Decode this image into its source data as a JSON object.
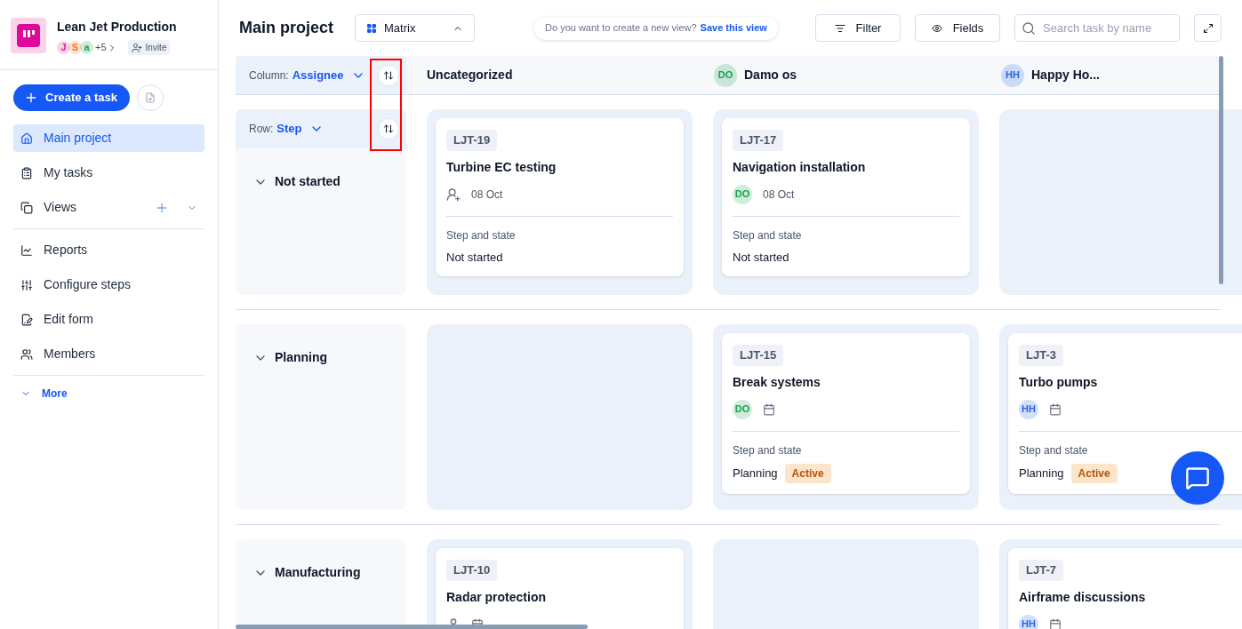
{
  "workspace": {
    "name": "Lean Jet Production",
    "members": [
      {
        "initial": "J",
        "color": "#e11d8f"
      },
      {
        "initial": "S",
        "color": "#f97316"
      },
      {
        "initial": "a",
        "color": "#16a34a"
      }
    ],
    "more_count": "+5",
    "invite": "Invite"
  },
  "create_button": "Create a task",
  "nav": [
    {
      "label": "Main project",
      "selected": true
    },
    {
      "label": "My tasks",
      "selected": false
    },
    {
      "label": "Views",
      "selected": false,
      "kind": "expandable"
    },
    {
      "label": "Reports",
      "selected": false
    },
    {
      "label": "Configure steps",
      "selected": false
    },
    {
      "label": "Edit form",
      "selected": false
    },
    {
      "label": "Members",
      "selected": false
    }
  ],
  "more": "More",
  "header": {
    "title": "Main project",
    "view": "Matrix",
    "prompt": "Do you want to create a new view?",
    "save_link": "Save this view",
    "filter": "Filter",
    "fields": "Fields",
    "search_placeholder": "Search task by name"
  },
  "column_control": {
    "label": "Column:",
    "value": "Assignee"
  },
  "row_control": {
    "label": "Row:",
    "value": "Step"
  },
  "columns": [
    {
      "label": "Uncategorized"
    },
    {
      "label": "Damo os",
      "avatar": {
        "initials": "DO",
        "color": "#16a34a"
      }
    },
    {
      "label": "Happy Ho...",
      "avatar": {
        "initials": "HH",
        "color": "#2563eb"
      }
    }
  ],
  "rows": [
    {
      "label": "Not started",
      "expanded": true,
      "cells": [
        {
          "id": "LJT-19",
          "title": "Turbine EC testing",
          "assignee": {
            "kind": "add"
          },
          "date": "08 Oct",
          "step_label": "Step and state",
          "step": "Not started"
        },
        {
          "id": "LJT-17",
          "title": "Navigation installation",
          "assignee": {
            "kind": "avatar",
            "initials": "DO",
            "color": "#16a34a"
          },
          "date": "08 Oct",
          "step_label": "Step and state",
          "step": "Not started"
        },
        null
      ]
    },
    {
      "label": "Planning",
      "expanded": true,
      "cells": [
        null,
        {
          "id": "LJT-15",
          "title": "Break systems",
          "assignee": {
            "kind": "avatar",
            "initials": "DO",
            "color": "#16a34a"
          },
          "step_label": "Step and state",
          "step": "Planning",
          "badge": "Active"
        },
        {
          "id": "LJT-3",
          "title": "Turbo pumps",
          "assignee": {
            "kind": "avatar",
            "initials": "HH",
            "color": "#2563eb"
          },
          "step_label": "Step and state",
          "step": "Planning",
          "badge": "Active"
        }
      ]
    },
    {
      "label": "Manufacturing",
      "expanded": true,
      "cells": [
        {
          "id": "LJT-10",
          "title": "Radar protection",
          "assignee": {
            "kind": "person"
          }
        },
        null,
        {
          "id": "LJT-7",
          "title": "Airframe discussions",
          "assignee": {
            "kind": "avatar",
            "initials": "HH",
            "color": "#2563eb"
          }
        }
      ]
    }
  ]
}
